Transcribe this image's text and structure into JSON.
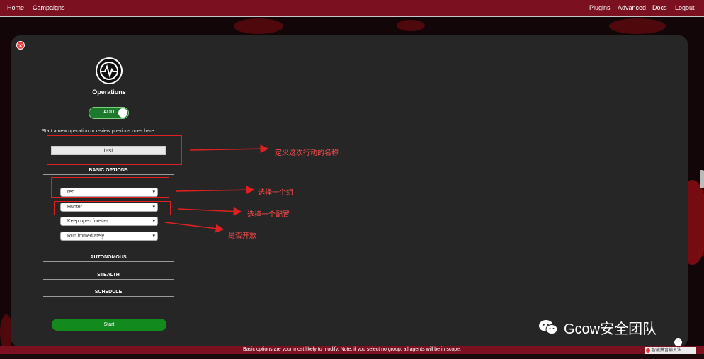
{
  "nav": {
    "left": [
      "Home",
      "Campaigns"
    ],
    "right": [
      "Plugins",
      "Advanced",
      "Docs",
      "Logout"
    ]
  },
  "panel": {
    "title": "Operations",
    "toggle_label": "ADD",
    "intro": "Start a new operation or review previous ones here.",
    "operation_name": "test",
    "sections": {
      "basic": "BASIC OPTIONS",
      "autonomous": "AUTONOMOUS",
      "stealth": "STEALTH",
      "schedule": "SCHEDULE"
    },
    "selects": {
      "group": "red",
      "adversary": "Hunter",
      "visibility": "Keep open forever",
      "run_mode": "Run immediately"
    },
    "start_label": "Start"
  },
  "annotations": {
    "name": "定义这次行动的名称",
    "group": "选择一个组",
    "adversary": "选择一个配置",
    "open": "是否开放"
  },
  "status": "Basic options are your most likely to modify. Note, if you select no group, all agents will be in scope.",
  "ime": "智能拼音输入法",
  "watermark": "Gcow安全团队",
  "icons": [
    "close-icon",
    "heartbeat-icon",
    "wechat-icon",
    "caret-down-icon"
  ],
  "colors": {
    "nav": "#7a1020",
    "modal": "#262626",
    "toggle_on": "#1d7a2c",
    "start": "#138a1e",
    "annotation": "#e02020"
  }
}
